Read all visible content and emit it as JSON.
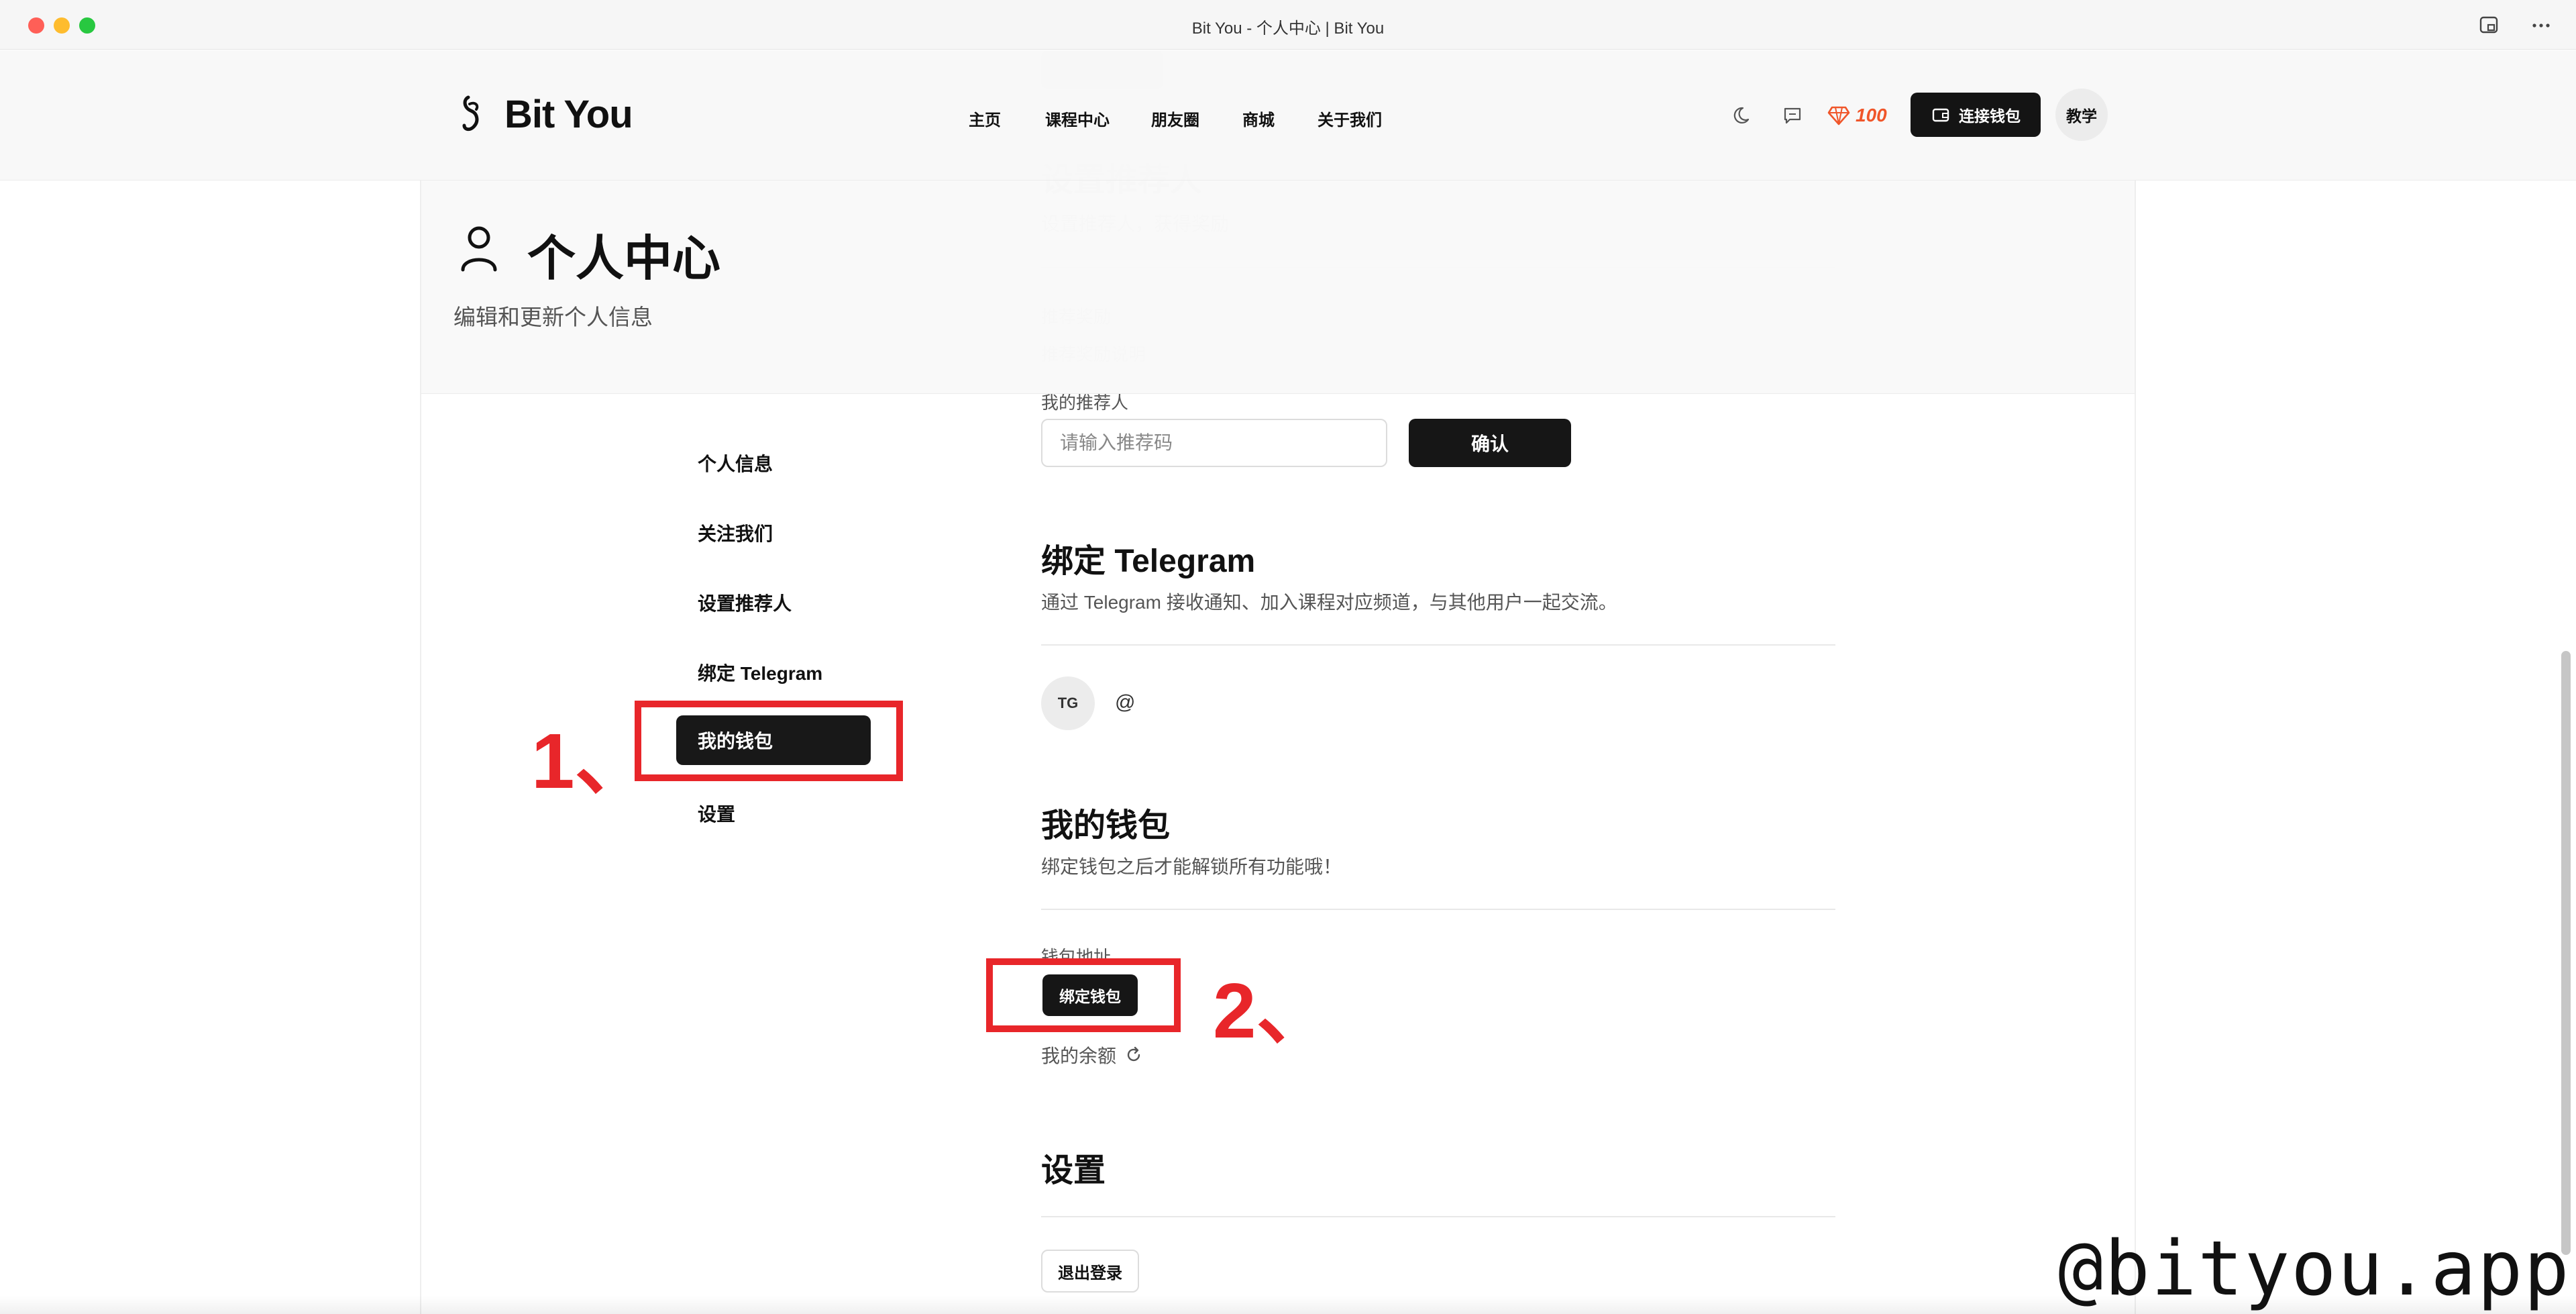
{
  "window": {
    "title": "Bit You - 个人中心 | Bit You"
  },
  "header": {
    "logo": "Bit You",
    "nav": [
      "主页",
      "课程中心",
      "朋友圈",
      "商城",
      "关于我们"
    ],
    "points": "100",
    "connect_wallet": "连接钱包",
    "teach": "教学"
  },
  "profile": {
    "title": "个人中心",
    "subtitle": "编辑和更新个人信息"
  },
  "sidebar": {
    "items": [
      "个人信息",
      "关注我们",
      "设置推荐人",
      "绑定 Telegram",
      "我的钱包",
      "设置"
    ]
  },
  "referrer": {
    "label": "我的推荐人",
    "placeholder": "请输入推荐码",
    "confirm": "确认"
  },
  "telegram": {
    "title": "绑定 Telegram",
    "desc": "通过 Telegram 接收通知、加入课程对应频道，与其他用户一起交流。",
    "avatar": "TG",
    "handle": "@"
  },
  "wallet": {
    "title": "我的钱包",
    "desc": "绑定钱包之后才能解锁所有功能哦！",
    "address_label": "钱包地址",
    "bind_button": "绑定钱包",
    "balance_label": "我的余额"
  },
  "settings": {
    "title": "设置",
    "logout": "退出登录"
  },
  "annotations": {
    "step1": "1、",
    "step2": "2、"
  },
  "watermark": "@bityou.app",
  "colors": {
    "accent": "#161616",
    "points": "#f0562a",
    "annotation": "#e8262a"
  }
}
